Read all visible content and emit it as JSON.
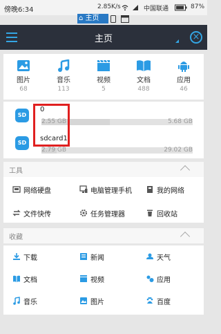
{
  "status": {
    "time": "傍晚6:34",
    "speed": "2.85K/s",
    "carrier": "中国联通",
    "battery": "87%",
    "home_tab": "主页"
  },
  "appbar": {
    "title": "主页"
  },
  "categories": [
    {
      "label": "图片",
      "count": "68",
      "icon": "image-icon"
    },
    {
      "label": "音乐",
      "count": "113",
      "icon": "music-icon"
    },
    {
      "label": "视频",
      "count": "5",
      "icon": "video-icon"
    },
    {
      "label": "文档",
      "count": "488",
      "icon": "document-icon"
    },
    {
      "label": "应用",
      "count": "46",
      "icon": "android-icon"
    }
  ],
  "storage": [
    {
      "name": "0",
      "used": "2.55 GB",
      "total": "5.68 GB",
      "fill": 0.45,
      "icon_label": "SD"
    },
    {
      "name": "sdcard1",
      "used": "2.79 GB",
      "total": "29.02 GB",
      "fill": 0.1,
      "icon_label": "SD"
    }
  ],
  "tools": {
    "title": "工具",
    "items": [
      {
        "label": "网络硬盘",
        "icon": "network-drive-icon"
      },
      {
        "label": "电脑管理手机",
        "icon": "pc-manage-icon"
      },
      {
        "label": "我的网络",
        "icon": "my-network-icon"
      },
      {
        "label": "文件快传",
        "icon": "file-transfer-icon"
      },
      {
        "label": "任务管理器",
        "icon": "task-manager-icon"
      },
      {
        "label": "回收站",
        "icon": "recycle-bin-icon"
      }
    ]
  },
  "favorites": {
    "title": "收藏",
    "items": [
      {
        "label": "下载",
        "icon": "download-icon"
      },
      {
        "label": "新闻",
        "icon": "news-icon"
      },
      {
        "label": "天气",
        "icon": "weather-icon"
      },
      {
        "label": "文档",
        "icon": "document-icon"
      },
      {
        "label": "视频",
        "icon": "video-icon"
      },
      {
        "label": "应用",
        "icon": "apps-icon"
      },
      {
        "label": "音乐",
        "icon": "music-icon"
      },
      {
        "label": "图片",
        "icon": "image-icon"
      },
      {
        "label": "百度",
        "icon": "baidu-icon"
      }
    ]
  },
  "colors": {
    "accent": "#34a6e4",
    "appbar": "#2b303b",
    "highlight": "#e02020"
  }
}
